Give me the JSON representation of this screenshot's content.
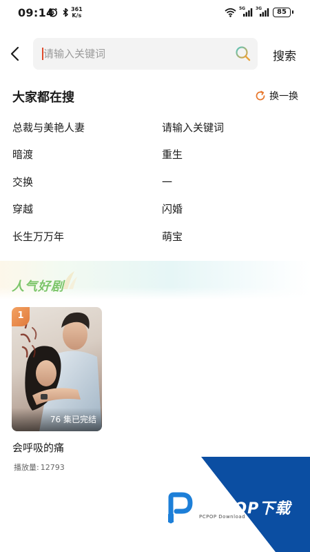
{
  "status_bar": {
    "time": "09:14",
    "net_speed_value": "361",
    "net_speed_unit": "K/s",
    "signal1_label": "5G",
    "signal2_label": "3G",
    "battery": "85"
  },
  "search": {
    "placeholder": "请输入关键词",
    "button_label": "搜索"
  },
  "hot_searches": {
    "title": "大家都在搜",
    "refresh_label": "换一换",
    "items": [
      "总裁与美艳人妻",
      "请输入关键词",
      "暗渡",
      "重生",
      "交换",
      "一",
      "穿越",
      "闪婚",
      "长生万万年",
      "萌宝"
    ]
  },
  "popular": {
    "title": "人气好剧",
    "dramas": [
      {
        "rank": "1",
        "episodes": "76 集已完结",
        "title": "会呼吸的痛",
        "play_label": "播放量:",
        "play_count": "12793",
        "poster_caption": "会呼吸的痛"
      }
    ]
  },
  "watermark": {
    "text": "PCPOP下载",
    "subtext": "PCPOP Download"
  },
  "colors": {
    "accent_orange": "#e8792f",
    "popular_green": "#7cc56a",
    "caret_red": "#e04a2b",
    "watermark_blue": "#0b4ea2"
  }
}
